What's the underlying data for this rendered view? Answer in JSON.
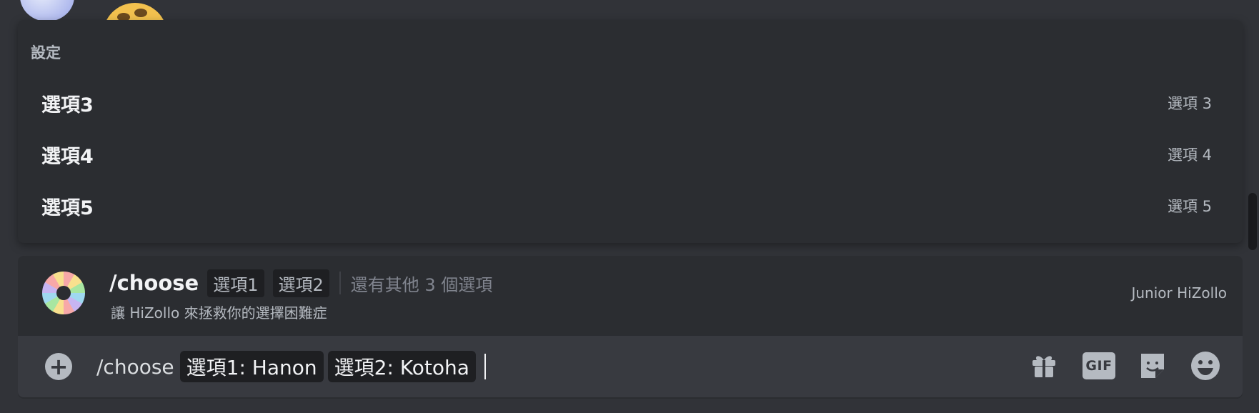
{
  "popup": {
    "title": "設定",
    "options": [
      {
        "label": "選項3",
        "description": "選項 3"
      },
      {
        "label": "選項4",
        "description": "選項 4"
      },
      {
        "label": "選項5",
        "description": "選項 5"
      }
    ]
  },
  "command": {
    "name": "/choose",
    "params": [
      "選項1",
      "選項2"
    ],
    "more": "還有其他 3 個選項",
    "description": "讓 HiZollo 來拯救你的選擇困難症",
    "bot_name": "Junior HiZollo"
  },
  "input": {
    "add_icon": "plus-circle-icon",
    "command": "/choose",
    "params": [
      "選項1: Hanon",
      "選項2: Kotoha"
    ]
  },
  "toolbar": {
    "gift_icon": "gift-icon",
    "gif_label": "GIF",
    "sticker_icon": "sticker-icon",
    "emoji_icon": "emoji-icon"
  },
  "colors": {
    "background": "#313338",
    "popup": "#2b2d31",
    "input": "#383a40",
    "chip": "#1e1f22",
    "muted_text": "#b5bac1"
  }
}
